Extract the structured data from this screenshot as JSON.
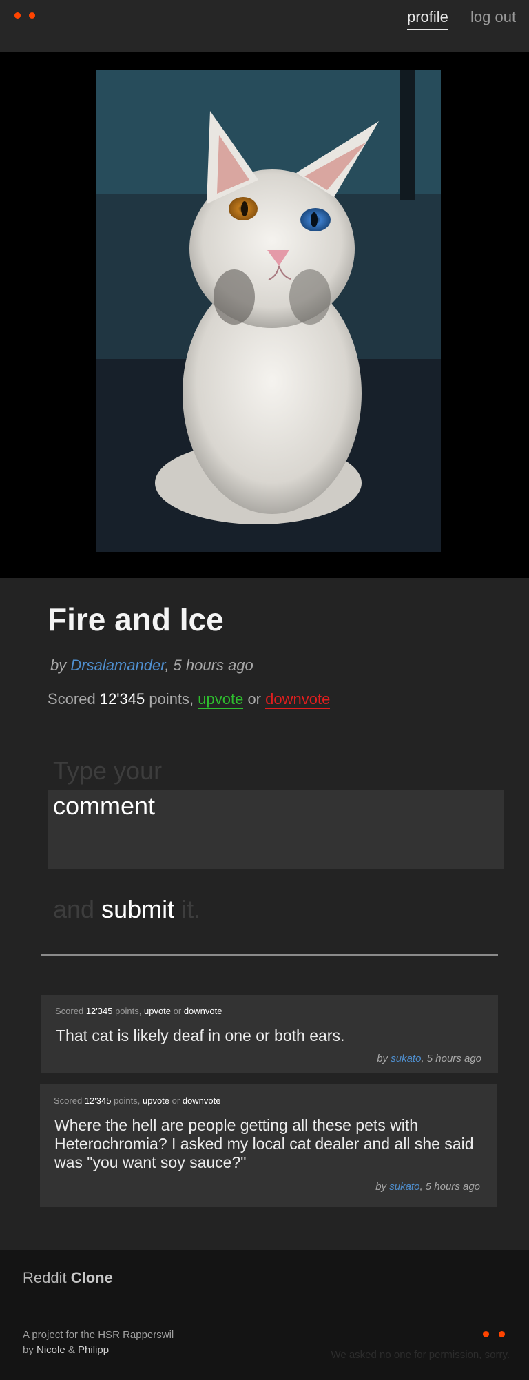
{
  "header": {
    "nav": {
      "profile_label": "profile",
      "logout_label": "log out"
    },
    "accent_color": "#ff4400"
  },
  "post": {
    "title": "Fire and Ice",
    "byline_prefix": "by ",
    "author": "Drsalamander",
    "time": ", 5 hours ago",
    "score_prefix": "Scored ",
    "score": "12'345",
    "score_suffix": " points, ",
    "upvote_label": "upvote",
    "or_label": " or ",
    "downvote_label": "downvote"
  },
  "comment_form": {
    "prompt_top": "Type your",
    "placeholder": "comment",
    "prompt_and": "and ",
    "submit_label": "submit",
    "prompt_end": " it."
  },
  "comments": [
    {
      "score_prefix": "Scored ",
      "score": "12'345",
      "score_suffix": " points, ",
      "upvote_label": "upvote",
      "or_label": " or ",
      "downvote_label": "downvote",
      "text": "That cat is likely deaf in one or both ears.",
      "by_prefix": "by ",
      "author": "sukato",
      "time": ", 5 hours ago"
    },
    {
      "score_prefix": "Scored ",
      "score": "12'345",
      "score_suffix": " points, ",
      "upvote_label": "upvote",
      "or_label": " or ",
      "downvote_label": "downvote",
      "text": "Where the hell are people getting all these pets with Heterochromia? I asked my local cat dealer and all she said was \"you want soy sauce?\"",
      "by_prefix": "by ",
      "author": "sukato",
      "time": ", 5 hours ago"
    }
  ],
  "footer": {
    "brand_light": "Reddit ",
    "brand_bold": "Clone",
    "info_line1": "A project for the HSR Rapperswil",
    "info_by": "by ",
    "name1": "Nicole",
    "amp": " & ",
    "name2": "Philipp",
    "note": "We asked no one for permission, sorry."
  },
  "colors": {
    "upvote": "#2ebd2e",
    "downvote": "#e01e1e",
    "author_link": "#4f8fcf"
  }
}
